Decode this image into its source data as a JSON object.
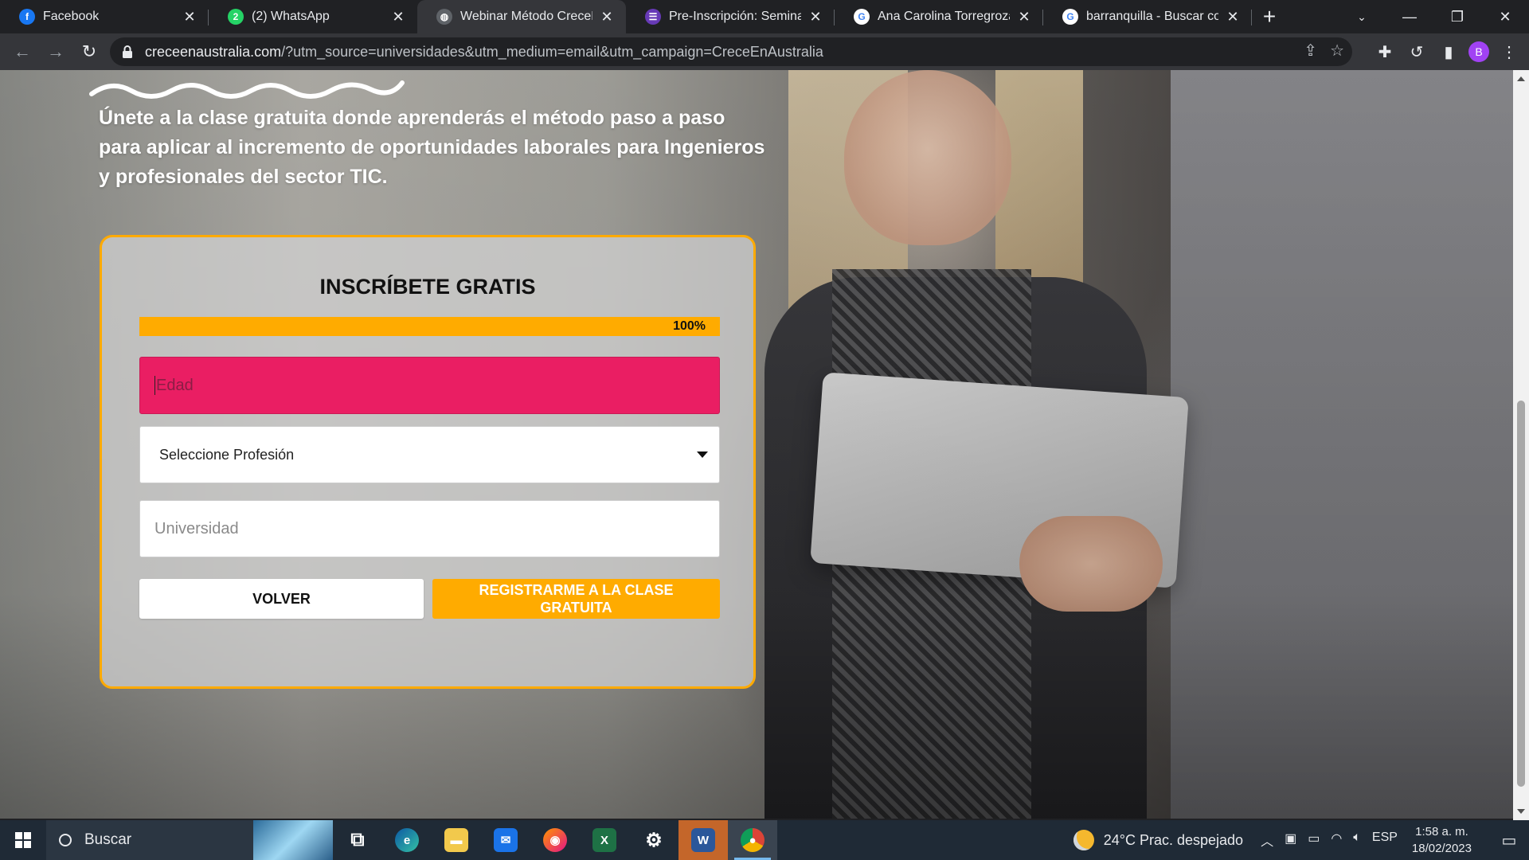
{
  "browser": {
    "tabs": [
      {
        "title": "Facebook",
        "icon": "facebook-icon",
        "color": "#1877f2",
        "glyph": "f"
      },
      {
        "title": "(2) WhatsApp",
        "icon": "whatsapp-icon",
        "color": "#25d366",
        "glyph": "2"
      },
      {
        "title": "Webinar Método CreceEnAustralia",
        "icon": "globe-icon",
        "color": "#5f6368",
        "glyph": "◍"
      },
      {
        "title": "Pre-Inscripción: Seminario t",
        "icon": "forms-icon",
        "color": "#673ab7",
        "glyph": "☰"
      },
      {
        "title": "Ana Carolina Torregroza Esp",
        "icon": "google-icon",
        "color": "#ffffff",
        "glyph": "G"
      },
      {
        "title": "barranquilla - Buscar con Go",
        "icon": "google-icon",
        "color": "#ffffff",
        "glyph": "G"
      }
    ],
    "active_tab_index": 2,
    "url_host": "creceenaustralia.com",
    "url_rest": "/?utm_source=universidades&utm_medium=email&utm_campaign=CreceEnAustralia",
    "profile_initial": "B"
  },
  "page": {
    "headline": "Únete a la clase gratuita donde aprenderás el método paso a paso para aplicar al incremento de oportunidades laborales para Ingenieros y profesionales del sector TIC.",
    "form": {
      "title": "INSCRÍBETE GRATIS",
      "progress_value": 100,
      "progress_label": "100%",
      "age_placeholder": "Edad",
      "profession_selected": "Seleccione Profesión",
      "university_placeholder": "Universidad",
      "back_label": "VOLVER",
      "submit_label": "REGISTRARME A LA CLASE GRATUITA"
    },
    "colors": {
      "accent": "#ffab00",
      "error_field": "#ea1e63"
    }
  },
  "taskbar": {
    "search_placeholder": "Buscar",
    "apps": [
      "task-view-icon",
      "edge-icon",
      "file-explorer-icon",
      "mail-icon",
      "firefox-icon",
      "excel-icon",
      "settings-icon",
      "word-icon",
      "chrome-icon"
    ],
    "weather": "24°C  Prac. despejado",
    "language": "ESP",
    "time": "1:58 a. m.",
    "date": "18/02/2023"
  }
}
